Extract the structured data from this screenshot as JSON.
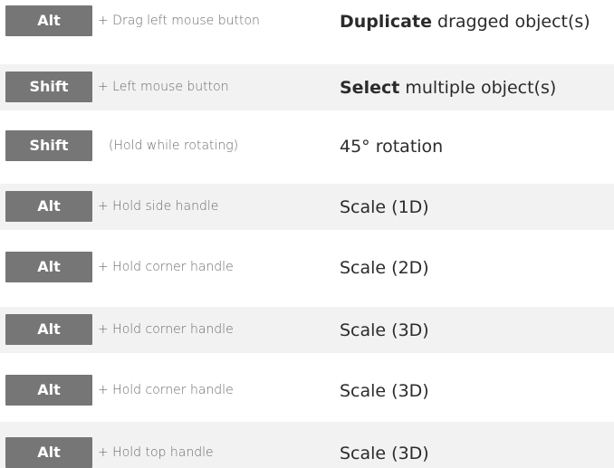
{
  "shortcuts": [
    {
      "key": "Alt",
      "modifier": "+ Drag left mouse button",
      "action_bold": "Duplicate",
      "action_rest": " dragged object(s)"
    },
    {
      "key": "Shift",
      "modifier": "+ Left mouse button",
      "action_bold": "Select",
      "action_rest": " multiple object(s)"
    },
    {
      "key": "Shift",
      "modifier": "(Hold while rotating)",
      "action_bold": "",
      "action_rest": "45° rotation"
    },
    {
      "key": "Alt",
      "modifier": "+ Hold side handle",
      "action_bold": "",
      "action_rest": "Scale (1D)"
    },
    {
      "key": "Alt",
      "modifier": "+ Hold corner handle",
      "action_bold": "",
      "action_rest": "Scale (2D)"
    },
    {
      "key": "Alt",
      "modifier": "+ Hold corner handle",
      "action_bold": "",
      "action_rest": "Scale (3D)"
    },
    {
      "key": "Alt",
      "modifier": "+ Hold corner handle",
      "action_bold": "",
      "action_rest": "Scale (3D)"
    },
    {
      "key": "Alt",
      "modifier": "+ Hold top handle",
      "action_bold": "",
      "action_rest": "Scale (3D)"
    }
  ],
  "colors": {
    "key_background": "#767676",
    "key_text": "#ffffff",
    "row_shade": "#f2f2f2",
    "modifier_text": "#6b6b6b",
    "action_text": "#2b2b2b"
  }
}
